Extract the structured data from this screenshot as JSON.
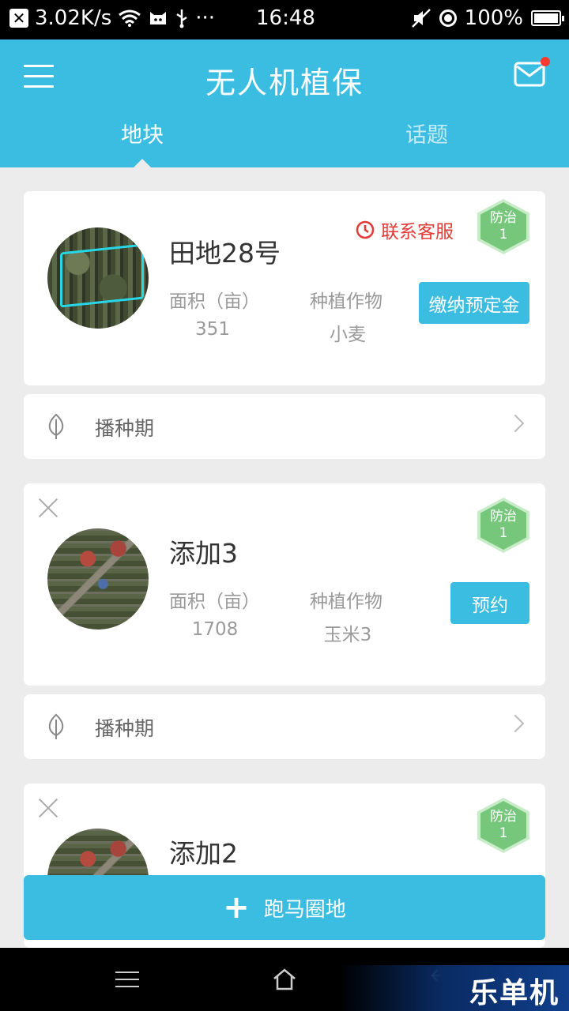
{
  "status_bar": {
    "net_speed": "3.02K/s",
    "dots": "···",
    "time": "16:48",
    "battery": "100%"
  },
  "header": {
    "title": "无人机植保",
    "tabs": [
      {
        "label": "地块",
        "active": true
      },
      {
        "label": "话题",
        "active": false
      }
    ]
  },
  "fields": [
    {
      "name": "田地28号",
      "area_label": "面积（亩）",
      "area_value": "351",
      "crop_label": "种植作物",
      "crop_value": "小麦",
      "contact_label": "联系客服",
      "badge_text": "防治",
      "badge_count": "1",
      "action_label": "缴纳预定金",
      "stage_label": "播种期",
      "closable": false
    },
    {
      "name": "添加3",
      "area_label": "面积（亩）",
      "area_value": "1708",
      "crop_label": "种植作物",
      "crop_value": "玉米3",
      "badge_text": "防治",
      "badge_count": "1",
      "action_label": "预约",
      "stage_label": "播种期",
      "closable": true
    },
    {
      "name": "添加2",
      "badge_text": "防治",
      "badge_count": "1",
      "closable": true
    }
  ],
  "bottom_action": {
    "label": "跑马圈地",
    "icon": "plus-icon"
  },
  "watermark": "乐单机",
  "colors": {
    "primary": "#3bbde2",
    "danger": "#e53935",
    "badge_green": "#76c77b",
    "background": "#ececec"
  }
}
